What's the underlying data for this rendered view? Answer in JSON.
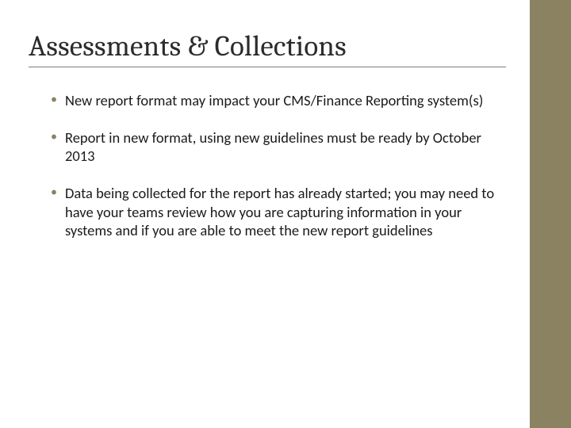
{
  "slide": {
    "title": "Assessments & Collections",
    "bullets": [
      "New report format may impact your CMS/Finance Reporting system(s)",
      "Report in new format, using new guidelines must be ready by October 2013",
      "Data being collected for the report has already started; you may need to have your teams review how you are capturing information in your systems and if you are able to meet the new report guidelines"
    ]
  },
  "theme": {
    "accent": "#8a8261"
  }
}
